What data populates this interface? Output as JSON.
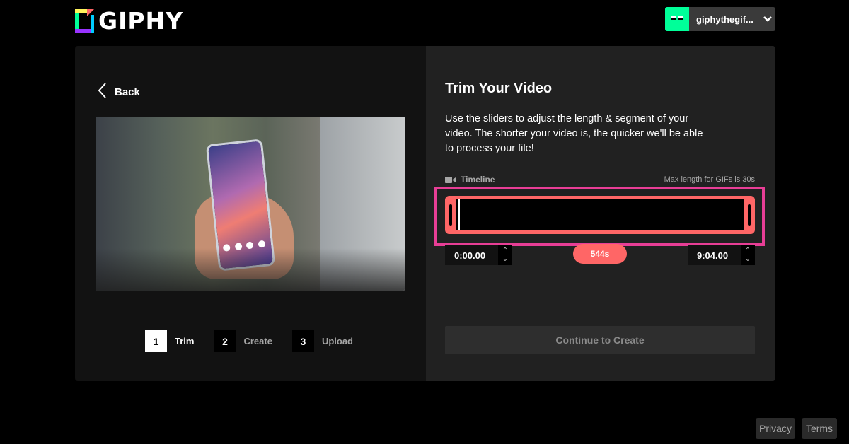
{
  "header": {
    "logo_text": "GIPHY",
    "username": "giphythegif...",
    "avatar_color": "#00ff99"
  },
  "left": {
    "back_label": "Back",
    "steps": [
      {
        "number": "1",
        "label": "Trim",
        "active": true
      },
      {
        "number": "2",
        "label": "Create",
        "active": false
      },
      {
        "number": "3",
        "label": "Upload",
        "active": false
      }
    ]
  },
  "right": {
    "title": "Trim Your Video",
    "description": "Use the sliders to adjust the length & segment of your video. The shorter your video is, the quicker we'll be able to process your file!",
    "timeline_label": "Timeline",
    "max_length_note": "Max length for GIFs is 30s",
    "start_time": "0:00.00",
    "end_time": "9:04.00",
    "duration": "544s",
    "continue_label": "Continue to Create",
    "accent_color": "#ff6666",
    "highlight_color": "#e83e96"
  },
  "footer": {
    "privacy_label": "Privacy",
    "terms_label": "Terms"
  }
}
